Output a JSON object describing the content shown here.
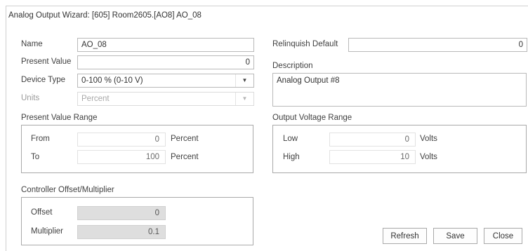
{
  "window": {
    "title": "Analog Output Wizard: [605] Room2605.[AO8] AO_08"
  },
  "left": {
    "name": {
      "label": "Name",
      "value": "AO_08"
    },
    "present_value": {
      "label": "Present Value",
      "value": "0"
    },
    "device_type": {
      "label": "Device Type",
      "value": "0-100 % (0-10 V)",
      "icon": "chevron-down-icon"
    },
    "units": {
      "label": "Units",
      "value": "Percent",
      "icon": "chevron-down-icon"
    },
    "range": {
      "title": "Present Value Range",
      "from": {
        "label": "From",
        "value": "0",
        "unit": "Percent"
      },
      "to": {
        "label": "To",
        "value": "100",
        "unit": "Percent"
      }
    },
    "controller": {
      "title": "Controller Offset/Multiplier",
      "offset": {
        "label": "Offset",
        "value": "0"
      },
      "multiplier": {
        "label": "Multiplier",
        "value": "0.1"
      }
    }
  },
  "right": {
    "relinquish_default": {
      "label": "Relinquish Default",
      "value": "0"
    },
    "description": {
      "label": "Description",
      "value": "Analog Output #8"
    },
    "voltage": {
      "title": "Output Voltage Range",
      "low": {
        "label": "Low",
        "value": "0",
        "unit": "Volts"
      },
      "high": {
        "label": "High",
        "value": "10",
        "unit": "Volts"
      }
    }
  },
  "buttons": {
    "refresh": "Refresh",
    "save": "Save",
    "close": "Close"
  }
}
